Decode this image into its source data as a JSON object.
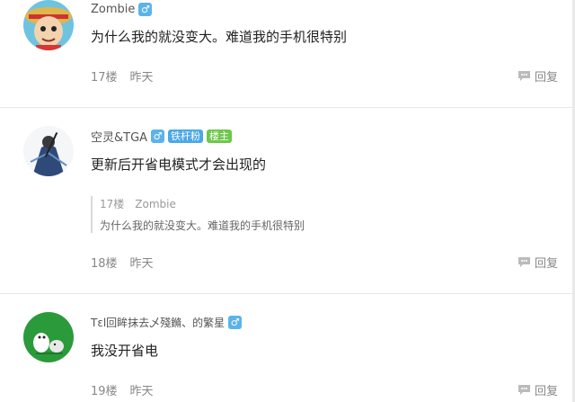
{
  "posts": [
    {
      "username": "Zombie",
      "gender_icon": "♂",
      "badges": [],
      "content": "为什么我的就没变大。难道我的手机很特别",
      "floor": "17楼",
      "time": "昨天",
      "reply_label": "回复"
    },
    {
      "username": "空灵&TGA",
      "gender_icon": "♂",
      "badges": [
        {
          "text": "铁杆粉",
          "color": "#4aa8e6"
        },
        {
          "text": "楼主",
          "color": "#6dc74b"
        }
      ],
      "content": "更新后开省电模式才会出现的",
      "quote": {
        "floor": "17楼",
        "username": "Zombie",
        "text": "为什么我的就没变大。难道我的手机很特别"
      },
      "floor": "18楼",
      "time": "昨天",
      "reply_label": "回复"
    },
    {
      "username": "Tεl回眸抹去乄殘鏅、的繁星",
      "gender_icon": "♂",
      "badges": [],
      "content": "我没开省电",
      "floor": "19楼",
      "time": "昨天",
      "reply_label": "回复"
    }
  ],
  "colors": {
    "gender_badge": "#5bb3ec",
    "divider": "#e7e7e7"
  }
}
